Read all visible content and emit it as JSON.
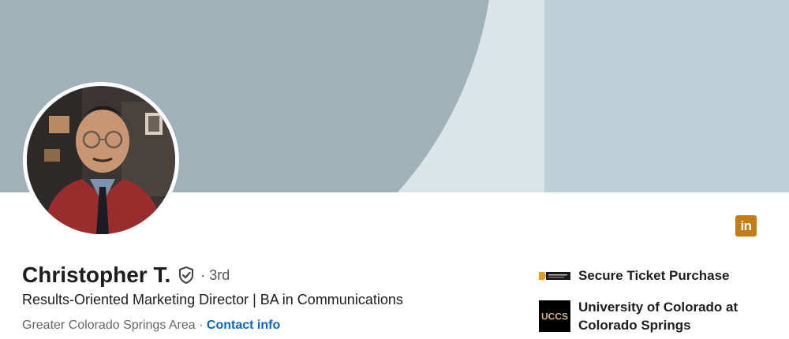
{
  "profile": {
    "name": "Christopher T.",
    "degree": "· 3rd",
    "headline": "Results-Oriented Marketing Director | BA in Communications",
    "location": "Greater Colorado Springs Area ·",
    "contact_info": "Contact info",
    "avatar_icon": "profile-photo"
  },
  "badge": {
    "label": "in",
    "icon": "linkedin-icon",
    "color": "#c37d16"
  },
  "experience": [
    {
      "label": "Secure Ticket Purchase",
      "icon": "ticket-company-logo"
    },
    {
      "label_line1": "University of Colorado at",
      "label_line2": "Colorado Springs",
      "logo_text": "UCCS",
      "icon": "uccs-logo"
    }
  ],
  "colors": {
    "banner_dark": "#a0b2b8",
    "banner_light": "#dbe4e8",
    "banner_right": "#bfd1d8",
    "link": "#0a66c2"
  }
}
